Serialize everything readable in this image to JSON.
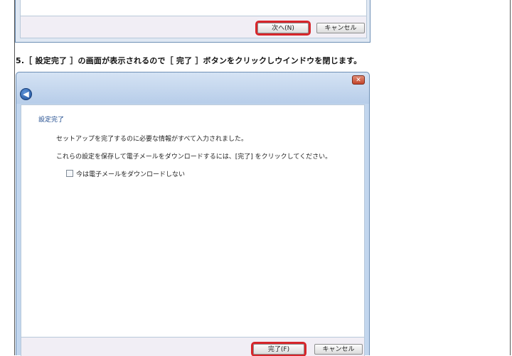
{
  "previous_dialog": {
    "next_button": "次へ(N)",
    "cancel_button": "キャンセル"
  },
  "instruction": "5.［ 設定完了 ］の画面が表示されるので［ 完了 ］ボタンをクリックしウインドウを閉じます。",
  "dialog": {
    "close_glyph": "✕",
    "back_glyph": "◀",
    "page_title": "設定完了",
    "message_1": "セットアップを完了するのに必要な情報がすべて入力されました。",
    "message_2": "これらの設定を保存して電子メールをダウンロードするには、[完了] をクリックしてください。",
    "checkbox_label": "今は電子メールをダウンロードしない",
    "checkbox_checked": false,
    "finish_button": "完了(F)",
    "cancel_button": "キャンセル"
  },
  "colors": {
    "highlight": "#d7262b",
    "dialog_frame": "#c2d6ee",
    "title_text": "#1f4b8e"
  }
}
